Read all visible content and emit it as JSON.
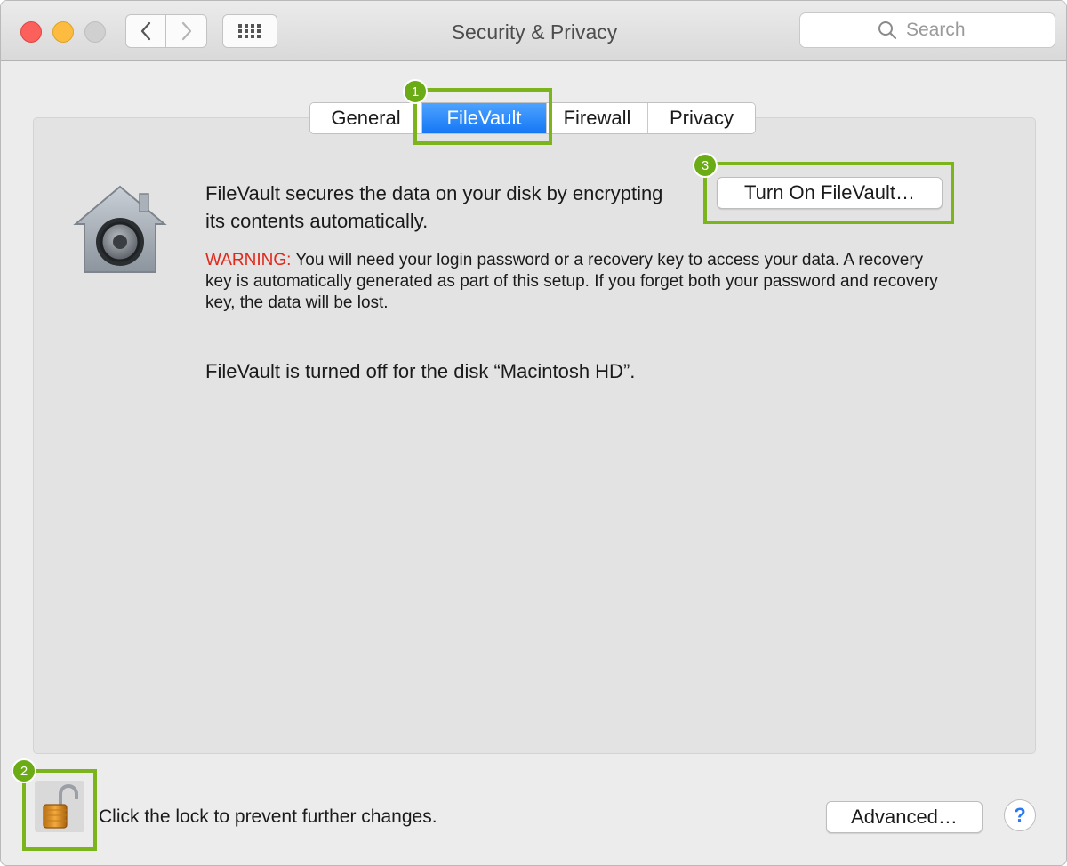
{
  "window": {
    "title": "Security & Privacy",
    "search_placeholder": "Search"
  },
  "tabs": [
    {
      "label": "General",
      "selected": false
    },
    {
      "label": "FileVault",
      "selected": true
    },
    {
      "label": "Firewall",
      "selected": false
    },
    {
      "label": "Privacy",
      "selected": false
    }
  ],
  "annotations": {
    "badge_1": "1",
    "badge_2": "2",
    "badge_3": "3",
    "highlight_color": "#7cb41c"
  },
  "filevault": {
    "description": "FileVault secures the data on your disk by encrypting its contents automatically.",
    "warning_label": "WARNING:",
    "warning_text": " You will need your login password or a recovery key to access your data. A recovery key is automatically generated as part of this setup. If you forget both your password and recovery key, the data will be lost.",
    "status": "FileVault is turned off for the disk “Macintosh HD”.",
    "turn_on_button": "Turn On FileVault…"
  },
  "footer": {
    "lock_text": "Click the lock to prevent further changes.",
    "advanced_button": "Advanced…",
    "help_label": "?"
  },
  "colors": {
    "selected_tab": "#1677f5",
    "warning": "#e0291c",
    "help": "#2b79f2"
  }
}
